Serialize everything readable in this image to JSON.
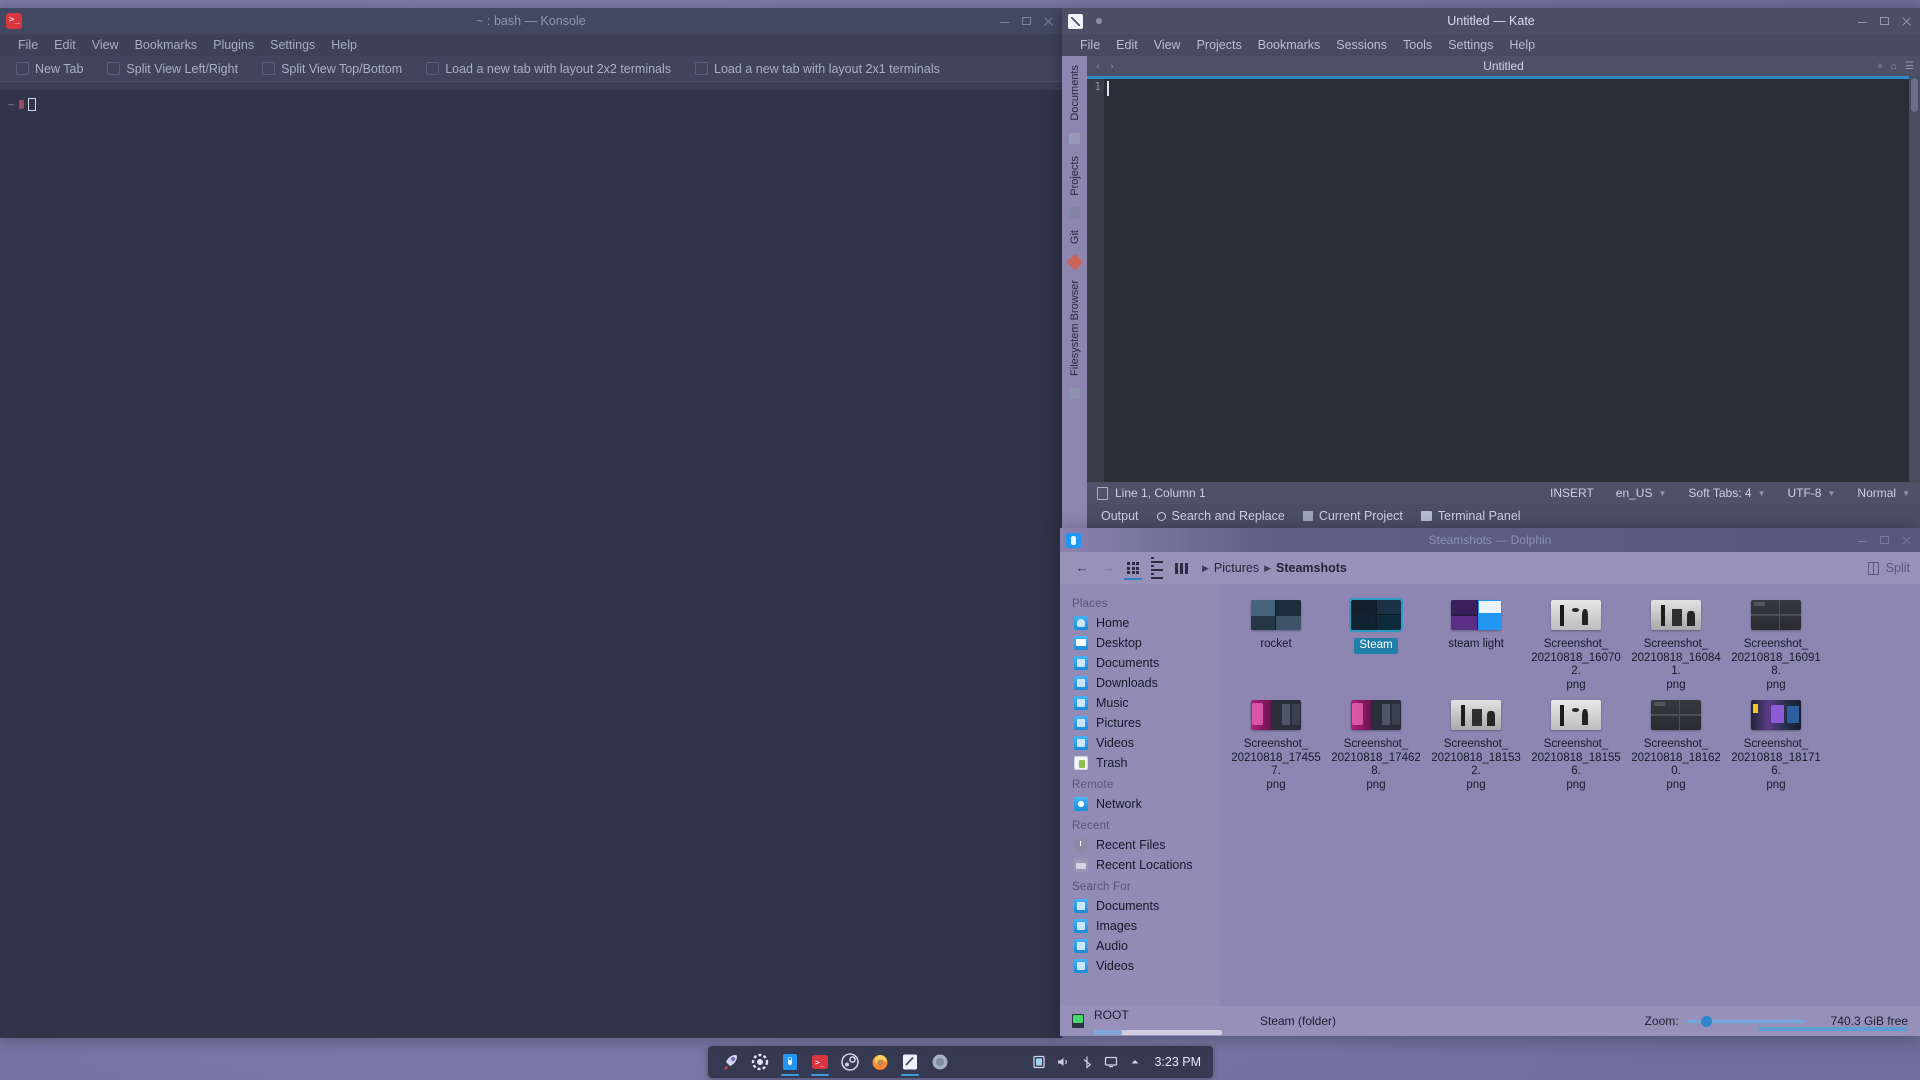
{
  "desktop": {
    "wallpaper_accent": "#a98ec8"
  },
  "konsole": {
    "title": "~ : bash — Konsole",
    "icon": "konsole-icon",
    "menu": [
      "File",
      "Edit",
      "View",
      "Bookmarks",
      "Plugins",
      "Settings",
      "Help"
    ],
    "toolbar": [
      "New Tab",
      "Split View Left/Right",
      "Split View Top/Bottom",
      "Load a new tab with layout 2x2 terminals",
      "Load a new tab with layout 2x1 terminals"
    ],
    "terminal": {
      "prompt": "~",
      "cursor": "block"
    },
    "window_buttons": [
      "minimize",
      "maximize",
      "close"
    ]
  },
  "kate": {
    "title": "Untitled — Kate",
    "icon": "kate-icon",
    "menu": [
      "File",
      "Edit",
      "View",
      "Projects",
      "Bookmarks",
      "Sessions",
      "Tools",
      "Settings",
      "Help"
    ],
    "sidebar": [
      "Documents",
      "Projects",
      "Git",
      "Filesystem Browser"
    ],
    "tab": {
      "name": "Untitled",
      "prev": "‹",
      "next": "›"
    },
    "editor": {
      "line_number": "1",
      "content": ""
    },
    "statusbar": {
      "position": "Line 1, Column 1",
      "mode": "INSERT",
      "language": "en_US",
      "tabs": "Soft Tabs: 4",
      "encoding": "UTF-8",
      "highlight": "Normal"
    },
    "bottombar": [
      "Output",
      "Search and Replace",
      "Current Project",
      "Terminal Panel"
    ],
    "window_buttons": [
      "minimize",
      "maximize",
      "close"
    ]
  },
  "dolphin": {
    "title": "Steamshots — Dolphin",
    "icon": "dolphin-icon",
    "toolbar": {
      "back": "←",
      "forward": "→",
      "view_modes": [
        "icons-view",
        "details-view",
        "compact-view"
      ],
      "active_view": "icons-view",
      "split_label": "Split"
    },
    "breadcrumb": [
      "Pictures",
      "Steamshots"
    ],
    "places": [
      {
        "section": "Places",
        "items": [
          {
            "label": "Home",
            "icon": "home-icon"
          },
          {
            "label": "Desktop",
            "icon": "desktop-icon"
          },
          {
            "label": "Documents",
            "icon": "folder-documents-icon"
          },
          {
            "label": "Downloads",
            "icon": "folder-downloads-icon"
          },
          {
            "label": "Music",
            "icon": "folder-music-icon"
          },
          {
            "label": "Pictures",
            "icon": "folder-pictures-icon"
          },
          {
            "label": "Videos",
            "icon": "folder-videos-icon"
          },
          {
            "label": "Trash",
            "icon": "trash-icon"
          }
        ]
      },
      {
        "section": "Remote",
        "items": [
          {
            "label": "Network",
            "icon": "network-icon"
          }
        ]
      },
      {
        "section": "Recent",
        "items": [
          {
            "label": "Recent Files",
            "icon": "clock-icon"
          },
          {
            "label": "Recent Locations",
            "icon": "recent-locations-icon"
          }
        ]
      },
      {
        "section": "Search For",
        "items": [
          {
            "label": "Documents",
            "icon": "search-documents-icon"
          },
          {
            "label": "Images",
            "icon": "search-images-icon"
          },
          {
            "label": "Audio",
            "icon": "search-audio-icon"
          },
          {
            "label": "Videos",
            "icon": "search-videos-icon"
          }
        ]
      }
    ],
    "files": [
      {
        "name": "rocket",
        "type": "folder",
        "selected": false,
        "thumb": "grey-collage"
      },
      {
        "name": "Steam",
        "type": "folder",
        "selected": true,
        "thumb": "dark-collage"
      },
      {
        "name": "steam light",
        "type": "folder",
        "selected": false,
        "thumb": "purple-collage"
      },
      {
        "name": "Screenshot_20210818_160702.png",
        "type": "image",
        "selected": false,
        "thumb": "grey-scene-a"
      },
      {
        "name": "Screenshot_20210818_160841.png",
        "type": "image",
        "selected": false,
        "thumb": "grey-scene-b"
      },
      {
        "name": "Screenshot_20210818_160918.png",
        "type": "image",
        "selected": false,
        "thumb": "dark-ui"
      },
      {
        "name": "Screenshot_20210818_174557.png",
        "type": "image",
        "selected": false,
        "thumb": "magenta-stage"
      },
      {
        "name": "Screenshot_20210818_174628.png",
        "type": "image",
        "selected": false,
        "thumb": "magenta-stage"
      },
      {
        "name": "Screenshot_20210818_181532.png",
        "type": "image",
        "selected": false,
        "thumb": "grey-scene-b"
      },
      {
        "name": "Screenshot_20210818_181556.png",
        "type": "image",
        "selected": false,
        "thumb": "grey-scene-a"
      },
      {
        "name": "Screenshot_20210818_181620.png",
        "type": "image",
        "selected": false,
        "thumb": "dark-ui"
      },
      {
        "name": "Screenshot_20210818_181716.png",
        "type": "image",
        "selected": false,
        "thumb": "dark-colorful"
      }
    ],
    "statusbar": {
      "device": "ROOT",
      "selection": "Steam (folder)",
      "zoom_label": "Zoom:",
      "free_space": "740.3 GiB free"
    }
  },
  "taskbar": {
    "launchers": [
      {
        "name": "rocket-launcher-icon"
      },
      {
        "name": "kde-settings-icon"
      },
      {
        "name": "dolphin-icon"
      },
      {
        "name": "konsole-icon"
      },
      {
        "name": "steam-icon"
      },
      {
        "name": "firefox-icon"
      },
      {
        "name": "kate-icon"
      },
      {
        "name": "browser-icon"
      }
    ],
    "tray": [
      "clipboard-icon",
      "volume-icon",
      "bluetooth-icon",
      "display-icon",
      "show-hidden-icon"
    ],
    "clock": "3:23 PM"
  }
}
